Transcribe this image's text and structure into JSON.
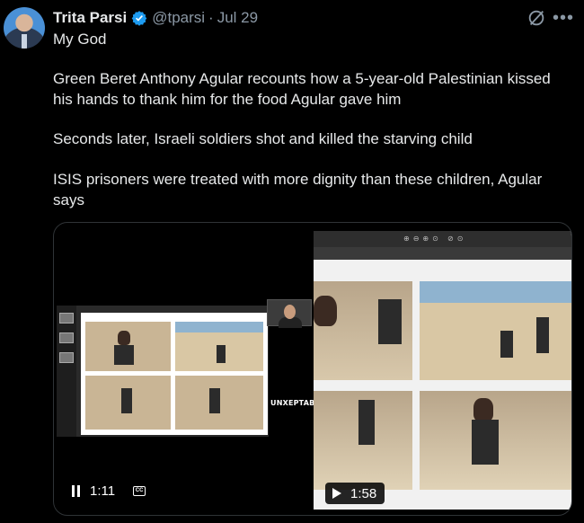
{
  "author": {
    "name": "Trita Parsi",
    "handle": "@tparsi",
    "separator": "·",
    "date": "Jul 29"
  },
  "icons": {
    "verified": "verified-badge-icon",
    "grok": "grok-icon",
    "more": "more-icon"
  },
  "colors": {
    "verified": "#1d9bf0",
    "background": "#000000",
    "secondary_text": "#8b98a5"
  },
  "tweet": {
    "line1": "My God",
    "para2": "Green Beret Anthony Agular recounts how a 5-year-old Palestinian kissed his hands to thank him for the food Agular gave him",
    "para3": "Seconds later, Israeli soldiers shot and killed the starving child",
    "para4": "ISIS prisoners were treated with more dignity than these children, Agular says"
  },
  "media": {
    "logo_text": "UNXEPTABLE",
    "left_video_time": "1:11",
    "cc_label": "CC",
    "right_video_time": "1:58"
  }
}
